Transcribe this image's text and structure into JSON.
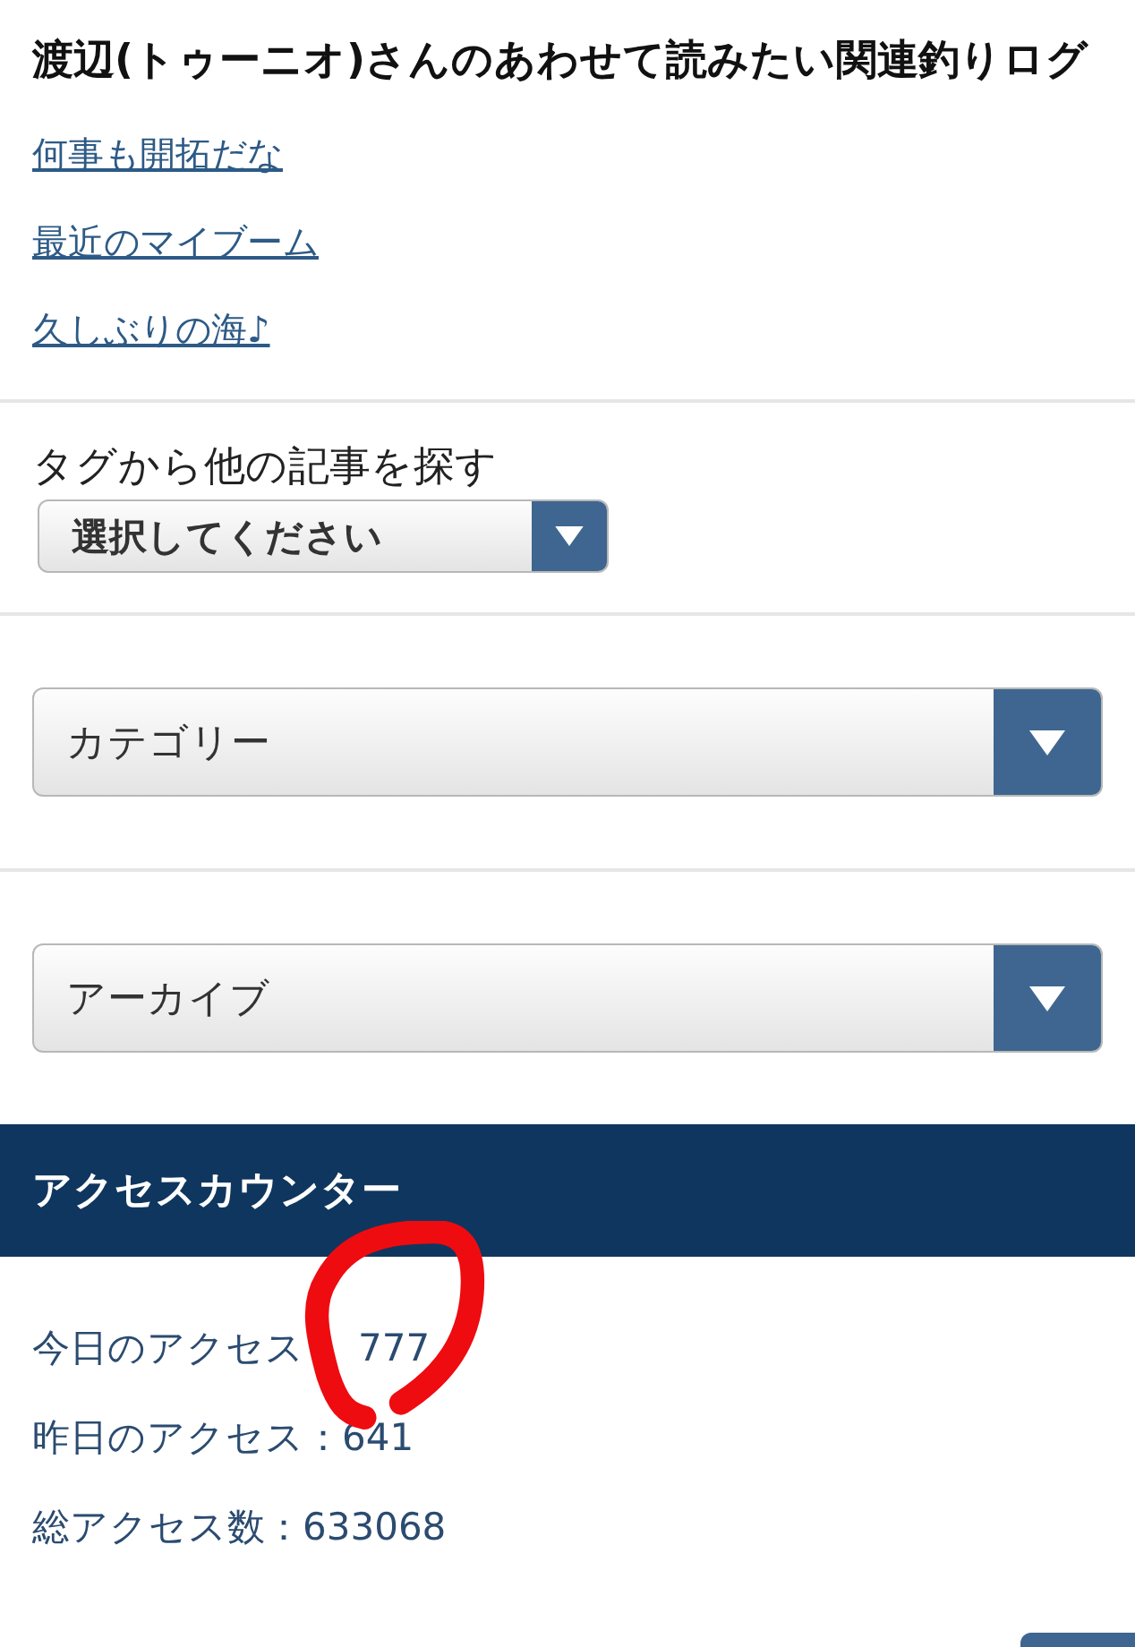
{
  "related": {
    "title": "渡辺(トゥーニオ)さんのあわせて読みたい関連釣りログ",
    "links": [
      "何事も開拓だな",
      "最近のマイブーム",
      "久しぶりの海♪"
    ]
  },
  "tag_search": {
    "label": "タグから他の記事を探す",
    "select": "選択してください"
  },
  "category_select": "カテゴリー",
  "archive_select": "アーカイブ",
  "access_counter": {
    "title": "アクセスカウンター",
    "rows": [
      {
        "label": "今日のアクセス",
        "value": "777"
      },
      {
        "label": "昨日のアクセス",
        "separator": "：",
        "value": "641"
      },
      {
        "label": "総アクセス数",
        "separator": "：",
        "value": "633068"
      }
    ]
  }
}
